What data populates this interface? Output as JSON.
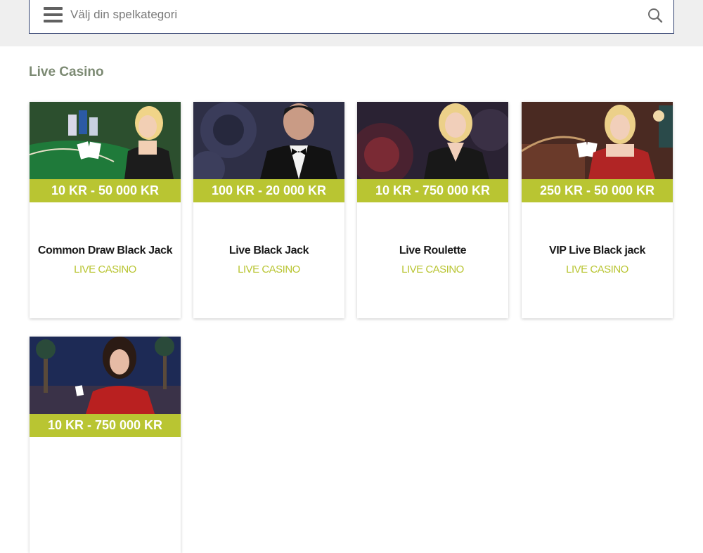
{
  "search": {
    "placeholder": "Välj din spelkategori"
  },
  "section": {
    "title": "Live Casino"
  },
  "games": [
    {
      "price": "10 KR - 50 000 KR",
      "name": "Common Draw Black Jack",
      "category": "LIVE CASINO"
    },
    {
      "price": "100 KR - 20 000 KR",
      "name": "Live Black Jack",
      "category": "LIVE CASINO"
    },
    {
      "price": "10 KR - 750 000 KR",
      "name": "Live Roulette",
      "category": "LIVE CASINO"
    },
    {
      "price": "250 KR - 50 000 KR",
      "name": "VIP Live Black jack",
      "category": "LIVE CASINO"
    },
    {
      "price": "10 KR - 750 000 KR",
      "name": "",
      "category": ""
    }
  ],
  "colors": {
    "accent": "#b9c532",
    "section_title": "#7c8a73",
    "search_border": "#2f3f6e"
  }
}
